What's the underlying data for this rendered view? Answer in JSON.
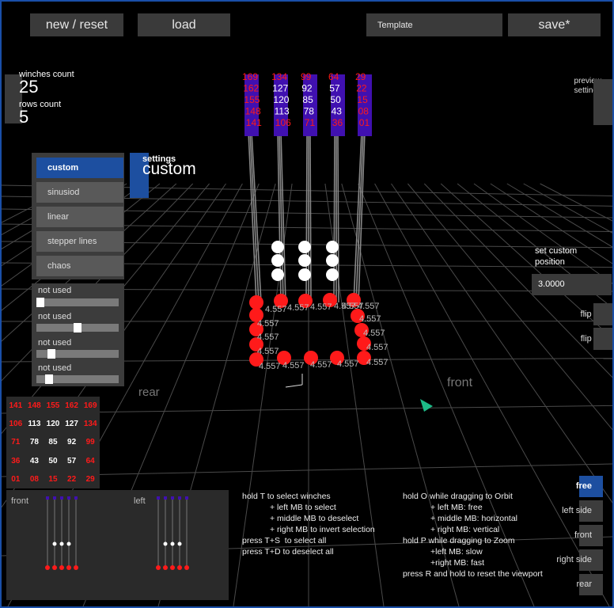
{
  "toolbar": {
    "new_reset": "new / reset",
    "load": "load",
    "template_value": "Template",
    "save": "save*"
  },
  "counts": {
    "winches_label": "winches count",
    "winches_value": "25",
    "rows_label": "rows count",
    "rows_value": "5"
  },
  "preview_settings": "preview settings",
  "modes": [
    {
      "label": "custom",
      "active": true
    },
    {
      "label": "sinusiod",
      "active": false
    },
    {
      "label": "linear",
      "active": false
    },
    {
      "label": "stepper lines",
      "active": false
    },
    {
      "label": "chaos",
      "active": false
    }
  ],
  "settings": {
    "label": "settings",
    "value": "custom"
  },
  "sliders": [
    {
      "label": "not used",
      "value": 0.0
    },
    {
      "label": "not used",
      "value": 0.5
    },
    {
      "label": "not used",
      "value": 0.15
    },
    {
      "label": "not used",
      "value": 0.12
    }
  ],
  "custom_position": {
    "label": "set custom position",
    "value": "3.0000",
    "flip_x": "flip X",
    "flip_y": "flip Y"
  },
  "winch_grid": [
    [
      {
        "t": "141",
        "c": "red"
      },
      {
        "t": "148",
        "c": "red"
      },
      {
        "t": "155",
        "c": "red"
      },
      {
        "t": "162",
        "c": "red"
      },
      {
        "t": "169",
        "c": "red"
      }
    ],
    [
      {
        "t": "106",
        "c": "red"
      },
      {
        "t": "113",
        "c": "white"
      },
      {
        "t": "120",
        "c": "white"
      },
      {
        "t": "127",
        "c": "white"
      },
      {
        "t": "134",
        "c": "red"
      }
    ],
    [
      {
        "t": "71",
        "c": "red"
      },
      {
        "t": "78",
        "c": "white"
      },
      {
        "t": "85",
        "c": "white"
      },
      {
        "t": "92",
        "c": "white"
      },
      {
        "t": "99",
        "c": "red"
      }
    ],
    [
      {
        "t": "36",
        "c": "red"
      },
      {
        "t": "43",
        "c": "white"
      },
      {
        "t": "50",
        "c": "white"
      },
      {
        "t": "57",
        "c": "white"
      },
      {
        "t": "64",
        "c": "red"
      }
    ],
    [
      {
        "t": "01",
        "c": "red"
      },
      {
        "t": "08",
        "c": "red"
      },
      {
        "t": "15",
        "c": "red"
      },
      {
        "t": "22",
        "c": "red"
      },
      {
        "t": "29",
        "c": "red"
      }
    ]
  ],
  "minimap": {
    "front": "front",
    "left": "left"
  },
  "scene": {
    "rear": "rear",
    "front": "front",
    "column_labels": [
      [
        {
          "t": "169",
          "c": "red"
        },
        {
          "t": "162",
          "c": "red"
        },
        {
          "t": "155",
          "c": "red"
        },
        {
          "t": "148",
          "c": "red"
        },
        {
          "t": "141",
          "c": "red"
        }
      ],
      [
        {
          "t": "134",
          "c": "red"
        },
        {
          "t": "127",
          "c": "white"
        },
        {
          "t": "120",
          "c": "white"
        },
        {
          "t": "113",
          "c": "white"
        },
        {
          "t": "106",
          "c": "red"
        }
      ],
      [
        {
          "t": "99",
          "c": "red"
        },
        {
          "t": "92",
          "c": "white"
        },
        {
          "t": "85",
          "c": "white"
        },
        {
          "t": "78",
          "c": "white"
        },
        {
          "t": "71",
          "c": "red"
        }
      ],
      [
        {
          "t": "64",
          "c": "red"
        },
        {
          "t": "57",
          "c": "white"
        },
        {
          "t": "50",
          "c": "white"
        },
        {
          "t": "43",
          "c": "white"
        },
        {
          "t": "36",
          "c": "red"
        }
      ],
      [
        {
          "t": "29",
          "c": "red"
        },
        {
          "t": "22",
          "c": "red"
        },
        {
          "t": "15",
          "c": "red"
        },
        {
          "t": "08",
          "c": "red"
        },
        {
          "t": "01",
          "c": "red"
        }
      ]
    ],
    "value_label": "4.557"
  },
  "help": {
    "select": "hold T to select winches\n            + left MB to select\n            + middle MB to deselect\n            + right MB to invert selection\npress T+S  to select all\npress T+D to deselect all",
    "view": "hold O while dragging to Orbit\n            + left MB: free\n            + middle MB: horizontal\n            + right MB: vertical\nhold P while dragging to Zoom\n            +left MB: slow\n            +right MB: fast\npress R and hold to reset the viewport"
  },
  "views": [
    {
      "label": "free",
      "active": true
    },
    {
      "label": "left side",
      "active": false
    },
    {
      "label": "front",
      "active": false
    },
    {
      "label": "right side",
      "active": false
    },
    {
      "label": "rear",
      "active": false
    }
  ],
  "colors": {
    "accent": "#1d4fa0",
    "winch_red": "#ff1a1a",
    "winch_blue": "#4010b0"
  }
}
